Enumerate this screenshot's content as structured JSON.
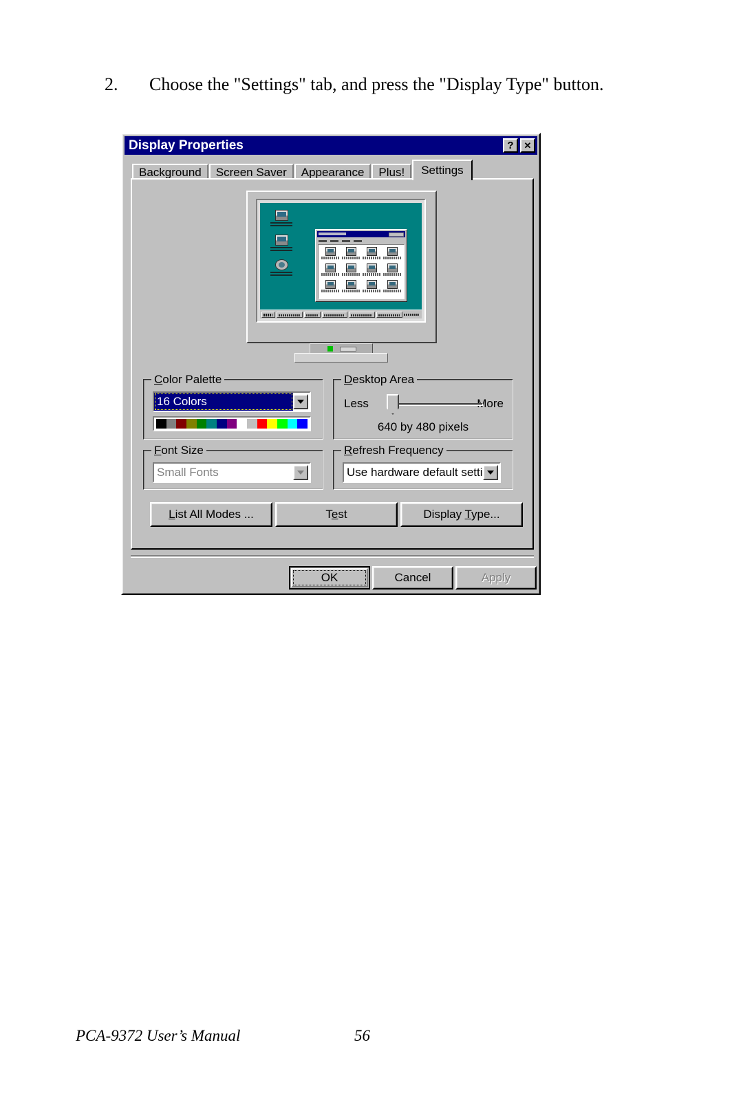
{
  "page": {
    "step_number": "2.",
    "instruction": "Choose the \"Settings\" tab, and press the \"Display Type\" button.",
    "footer_title": "PCA-9372 User’s Manual",
    "footer_page": "56"
  },
  "dialog": {
    "title": "Display Properties",
    "help_button": "?",
    "close_button": "✕",
    "tabs": [
      {
        "label": "Background",
        "active": false
      },
      {
        "label": "Screen Saver",
        "active": false
      },
      {
        "label": "Appearance",
        "active": false
      },
      {
        "label": "Plus!",
        "active": false
      },
      {
        "label": "Settings",
        "active": true
      }
    ],
    "color_palette": {
      "legend_accel": "C",
      "legend_rest": "olor Palette",
      "selected": "16 Colors",
      "swatches": [
        "#000000",
        "#808080",
        "#800000",
        "#808000",
        "#008000",
        "#008080",
        "#000080",
        "#800080",
        "#ffffff",
        "#c0c0c0",
        "#ff0000",
        "#ffff00",
        "#00ff00",
        "#00ffff",
        "#0000ff"
      ]
    },
    "desktop_area": {
      "legend_accel": "D",
      "legend_rest": "esktop Area",
      "less_label": "Less",
      "more_label": "More",
      "resolution": "640 by 480 pixels"
    },
    "font_size": {
      "legend_accel": "F",
      "legend_rest": "ont Size",
      "selected": "Small Fonts",
      "disabled": true
    },
    "refresh_frequency": {
      "legend_accel": "R",
      "legend_rest": "efresh Frequency",
      "selected": "Use hardware default setting"
    },
    "buttons": {
      "list_all_modes_accel": "L",
      "list_all_modes_rest": "ist All Modes ...",
      "test_a": "T",
      "test_accel": "e",
      "test_rest": "st",
      "display_type_a": "Display ",
      "display_type_accel": "T",
      "display_type_rest": "ype...",
      "ok": "OK",
      "cancel": "Cancel",
      "apply": "Apply"
    }
  }
}
